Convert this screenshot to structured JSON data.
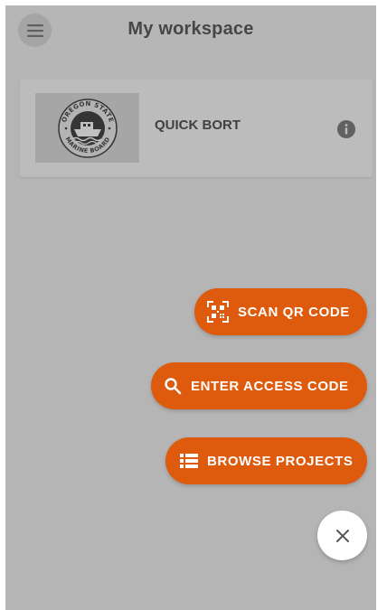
{
  "header": {
    "title": "My workspace",
    "menu_icon": "hamburger-menu-icon"
  },
  "project_card": {
    "name": "QUICK BORT",
    "thumbnail": {
      "logo_top_text": "OREGON STATE",
      "logo_bottom_text": "MARINE BOARD"
    },
    "info_icon": "info-icon"
  },
  "fab_menu": {
    "scan_qr": {
      "label": "SCAN QR CODE",
      "icon": "qr-scan-icon"
    },
    "enter_access": {
      "label": "ENTER ACCESS CODE",
      "icon": "search-icon"
    },
    "browse_projects": {
      "label": "BROWSE PROJECTS",
      "icon": "list-icon"
    },
    "close": {
      "icon": "close-icon"
    }
  },
  "colors": {
    "accent": "#de5a0c",
    "background": "#d6d6d6",
    "card": "#e1e1e1"
  }
}
